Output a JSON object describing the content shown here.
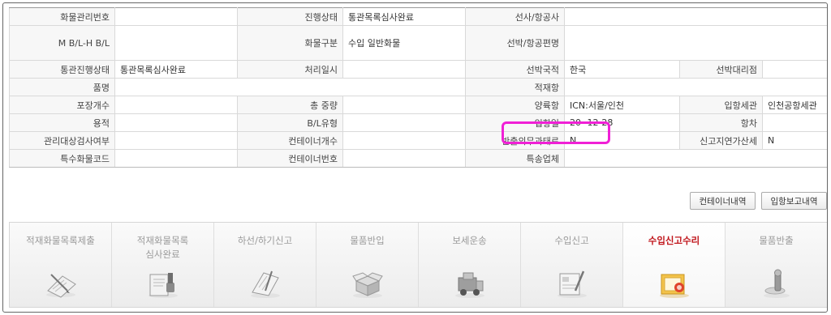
{
  "info_rows": [
    [
      {
        "l": "화물관리번호",
        "v": ""
      },
      {
        "l": "진행상태",
        "v": "통관목록심사완료"
      },
      {
        "l": "선사/항공사",
        "v": "",
        "span": 3
      }
    ],
    [
      {
        "l": "M B/L-H B/L",
        "v": ""
      },
      {
        "l": "화물구분",
        "v": "수입 일반화물"
      },
      {
        "l": "선박/항공편명",
        "v": "",
        "span": 3
      }
    ],
    [
      {
        "l": "통관진행상태",
        "v": "통관목록심사완료"
      },
      {
        "l": "처리일시",
        "v": ""
      },
      {
        "l": "선박국적",
        "v": "한국"
      },
      {
        "l": "선박대리점",
        "v": ""
      }
    ],
    [
      {
        "l": "품명",
        "v": "",
        "span": 3
      },
      {
        "l": "적재항",
        "v": "",
        "span": 3
      }
    ],
    [
      {
        "l": "포장개수",
        "v": ""
      },
      {
        "l": "총 중량",
        "v": ""
      },
      {
        "l": "양륙항",
        "v": "ICN:서울/인천"
      },
      {
        "l": "입항세관",
        "v": "인천공항세관"
      }
    ],
    [
      {
        "l": "용적",
        "v": ""
      },
      {
        "l": "B/L유형",
        "v": ""
      },
      {
        "l": "입항일",
        "v": "20   -12-28"
      },
      {
        "l": "항차",
        "v": ""
      }
    ],
    [
      {
        "l": "관리대상검사여부",
        "v": ""
      },
      {
        "l": "컨테이너개수",
        "v": ""
      },
      {
        "l": "반출의무과태료",
        "v": "N"
      },
      {
        "l": "신고지연가산세",
        "v": "N"
      }
    ],
    [
      {
        "l": "특수화물코드",
        "v": ""
      },
      {
        "l": "컨테이너번호",
        "v": ""
      },
      {
        "l": "특송업체",
        "v": "",
        "span": 3
      }
    ]
  ],
  "buttons": {
    "container_list": "컨테이너내역",
    "arrival_report": "입항보고내역"
  },
  "steps": [
    {
      "label": "적재화물목록제출",
      "icon": "clipboard-pen-icon",
      "active": false
    },
    {
      "label": "적재화물목록\n심사완료",
      "icon": "stamp-document-icon",
      "active": false
    },
    {
      "label": "하선/하기신고",
      "icon": "document-pen-icon",
      "active": false
    },
    {
      "label": "물품반입",
      "icon": "open-box-icon",
      "active": false
    },
    {
      "label": "보세운송",
      "icon": "forklift-truck-icon",
      "active": false
    },
    {
      "label": "수입신고",
      "icon": "form-pen-icon",
      "active": false
    },
    {
      "label": "수입신고수리",
      "icon": "approved-document-icon",
      "active": true
    },
    {
      "label": "물품반출",
      "icon": "release-stamp-icon",
      "active": false
    }
  ],
  "colors": {
    "highlight": "#f020d6",
    "active_step_text": "#c0141a",
    "label_bg": "#f7f7f7"
  }
}
